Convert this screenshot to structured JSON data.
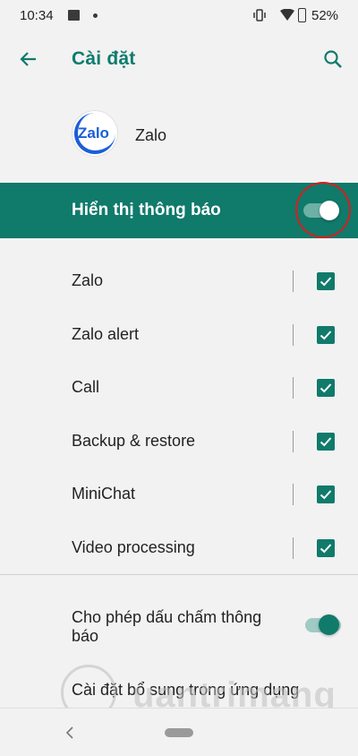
{
  "status_bar": {
    "time": "10:34",
    "battery": "52%",
    "icons": [
      "image-icon",
      "dot-icon",
      "vibrate-icon",
      "wifi-icon",
      "battery-icon"
    ]
  },
  "app_bar": {
    "title": "Cài đặt",
    "back_icon": "arrow-left-icon",
    "search_icon": "search-icon"
  },
  "app": {
    "name": "Zalo",
    "logo_text": "Zalo",
    "logo_color": "#1a5ed8"
  },
  "show_notifications": {
    "label": "Hiển thị thông báo",
    "enabled": true,
    "band_color": "#107a6b"
  },
  "channels": [
    {
      "label": "Zalo",
      "checked": true
    },
    {
      "label": "Zalo alert",
      "checked": true
    },
    {
      "label": "Call",
      "checked": true
    },
    {
      "label": "Backup & restore",
      "checked": true
    },
    {
      "label": "MiniChat",
      "checked": true
    },
    {
      "label": "Video processing",
      "checked": true
    }
  ],
  "notification_dots": {
    "label": "Cho phép dấu chấm thông báo",
    "enabled": true
  },
  "additional_settings": {
    "label": "Cài đặt bổ sung trong ứng dụng"
  },
  "watermark": {
    "text": "uantrimang"
  },
  "accent_color": "#107a6b"
}
